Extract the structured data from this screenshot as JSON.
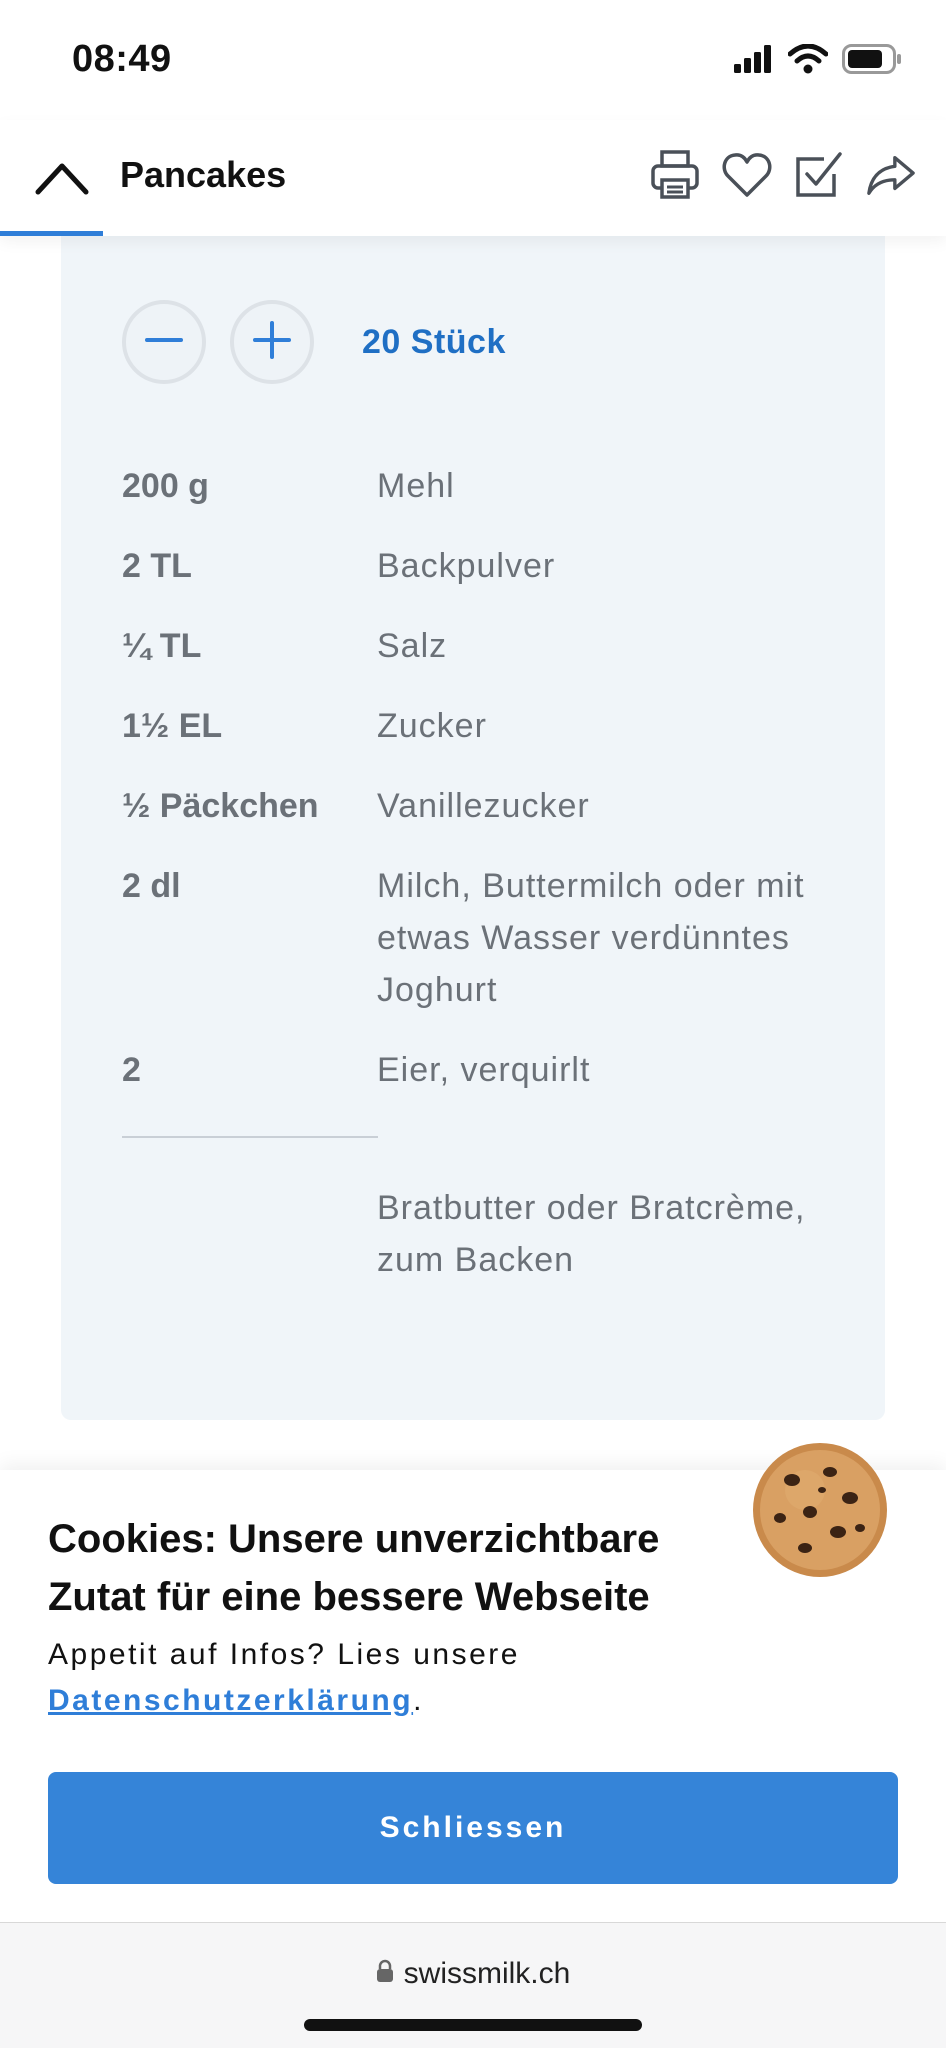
{
  "status": {
    "time": "08:49",
    "icons": [
      "signal-icon",
      "wifi-icon",
      "battery-icon"
    ]
  },
  "header": {
    "title": "Pancakes",
    "collapse_icon": "chevron-up-icon",
    "actions": [
      "print-icon",
      "heart-icon",
      "checkbox-icon",
      "share-icon"
    ],
    "accent": "#2f7ed8"
  },
  "recipe": {
    "servings_label": "20 Stück",
    "minus_icon": "minus-icon",
    "plus_icon": "plus-icon",
    "ingredients": [
      {
        "amount": "200 g",
        "name": "Mehl"
      },
      {
        "amount": "2 TL",
        "name": "Backpulver"
      },
      {
        "amount": "¼ TL",
        "name": "Salz"
      },
      {
        "amount": "1½ EL",
        "name": "Zucker"
      },
      {
        "amount": "½ Päckchen",
        "name": "Vanillezucker"
      },
      {
        "amount": "2 dl",
        "name": "Milch, Buttermilch oder mit etwas Wasser verdünntes Joghurt"
      },
      {
        "amount": "2",
        "name": "Eier, verquirlt"
      }
    ],
    "extra_ingredient": "Bratbutter oder Bratcrème, zum Backen"
  },
  "cookie_banner": {
    "title": "Cookies: Unsere unverzichtbare Zutat für eine bessere Webseite",
    "text_before": "Appetit auf Infos? Lies unsere ",
    "link_label": "Datenschutzerklärung",
    "text_after": ".",
    "close_label": "Schliessen",
    "image": "cookie-icon",
    "button_color": "#3584d8"
  },
  "browser": {
    "url": "swissmilk.ch",
    "lock_icon": "lock-icon"
  }
}
